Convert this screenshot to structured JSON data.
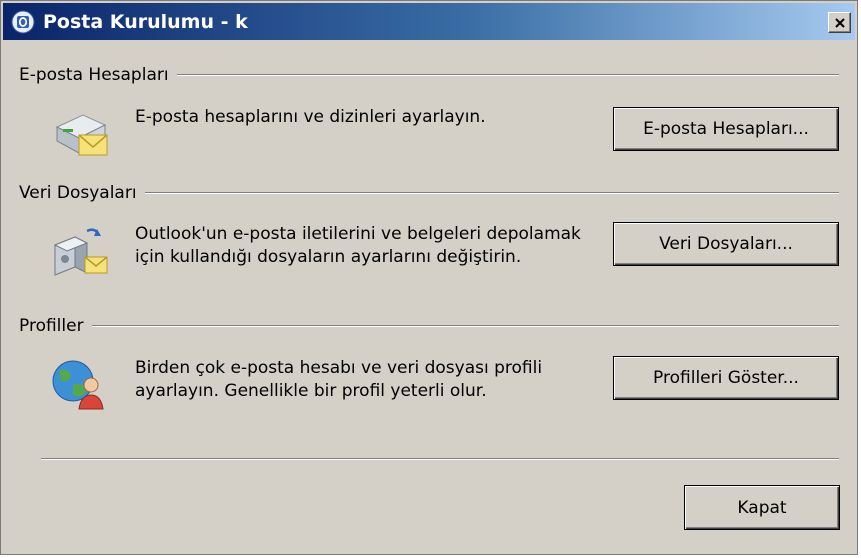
{
  "window": {
    "title": "Posta Kurulumu - k"
  },
  "sections": {
    "email": {
      "header": "E-posta Hesapları",
      "description": "E-posta hesaplarını ve dizinleri ayarlayın.",
      "button": "E-posta Hesapları..."
    },
    "data_files": {
      "header": "Veri Dosyaları",
      "description": "Outlook'un e-posta iletilerini ve belgeleri depolamak için kullandığı dosyaların ayarlarını değiştirin.",
      "button": "Veri Dosyaları..."
    },
    "profiles": {
      "header": "Profiller",
      "description": "Birden çok e-posta hesabı ve veri dosyası profili ayarlayın. Genellikle bir profil yeterli olur.",
      "button": "Profilleri Göster..."
    }
  },
  "footer": {
    "close_button": "Kapat"
  },
  "icons": {
    "title": "outlook-icon",
    "close": "close-icon",
    "email": "email-accounts-icon",
    "data_files": "data-files-icon",
    "profiles": "profiles-icon"
  },
  "colors": {
    "dialog_bg": "#d4d0c8",
    "titlebar_start": "#0a246a",
    "titlebar_end": "#a6caf0"
  }
}
